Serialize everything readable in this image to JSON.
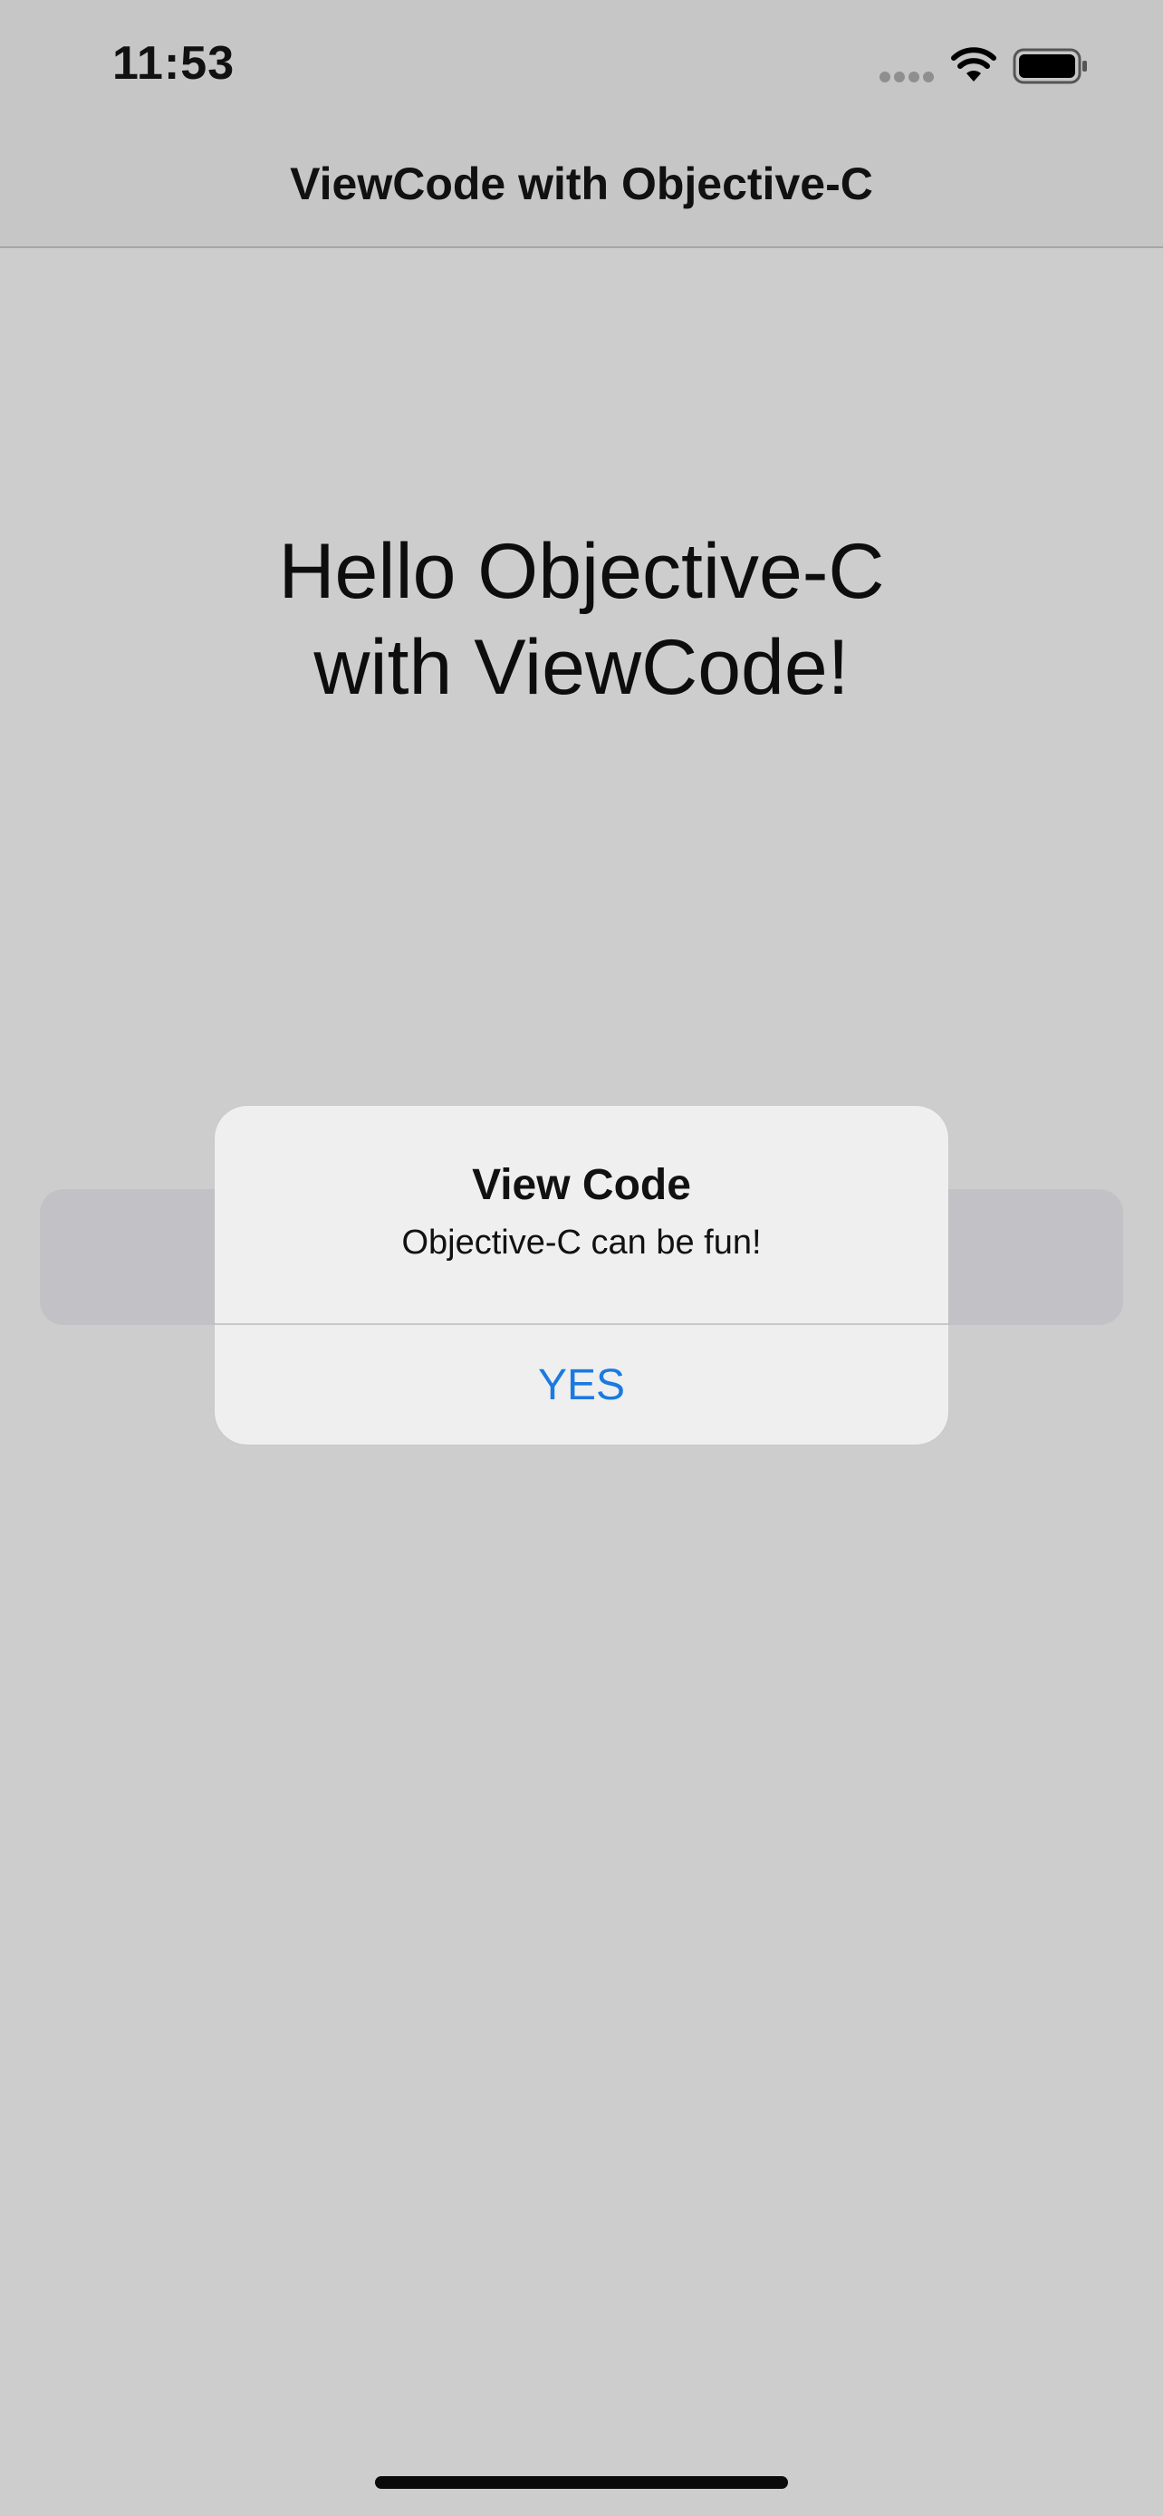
{
  "status_bar": {
    "time": "11:53",
    "icons": [
      "cellular-dots-icon",
      "wifi-icon",
      "battery-icon"
    ]
  },
  "nav_bar": {
    "title": "ViewCode with Objective-C"
  },
  "content": {
    "hello_line1": "Hello Objective-C",
    "hello_line2": "with ViewCode!"
  },
  "alert": {
    "title": "View Code",
    "message": "Objective-C can be fun!",
    "button_label": "YES"
  },
  "colors": {
    "background": "#cdcdcd",
    "bar_background": "#c6c6c6",
    "alert_background": "#efefef",
    "alert_button_text": "#1a7ae0",
    "hidden_button_background": "#c2c2c6"
  }
}
